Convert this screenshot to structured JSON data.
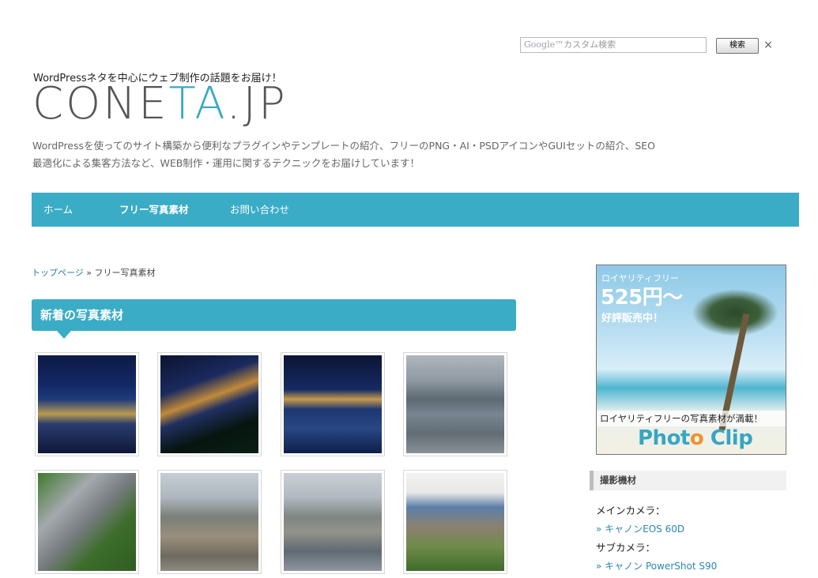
{
  "search": {
    "placeholder_brand": "Google™",
    "placeholder_text": "カスタム検索",
    "button_label": "検索",
    "close_label": "×"
  },
  "header": {
    "tagline": "WordPressネタを中心にウェブ制作の話題をお届け！",
    "logo_part1": "CONE",
    "logo_part2": "TA",
    "logo_part3": ".JP",
    "description_line1": "WordPressを使ってのサイト構築から便利なプラグインやテンプレートの紹介、フリーのPNG・AI・PSDアイコンやGUIセットの紹介、SEO",
    "description_line2": "最適化による集客方法など、WEB制作・運用に関するテクニックをお届けしています！"
  },
  "nav": {
    "items": [
      {
        "label": "ホーム"
      },
      {
        "label": "フリー写真素材"
      },
      {
        "label": "お問い合わせ"
      }
    ]
  },
  "breadcrumb": {
    "home": "トップページ",
    "separator": " » ",
    "current": "フリー写真素材"
  },
  "section": {
    "title": "新着の写真素材"
  },
  "photos": [
    {
      "icon": "night-city-photo"
    },
    {
      "icon": "night-harbor-photo"
    },
    {
      "icon": "night-port-photo"
    },
    {
      "icon": "marina-photo"
    },
    {
      "icon": "hillside-houses-photo"
    },
    {
      "icon": "city-skyline-photo"
    },
    {
      "icon": "river-town-photo"
    },
    {
      "icon": "cliff-building-photo"
    }
  ],
  "sidebar": {
    "banner": {
      "line1": "ロイヤリティフリー",
      "line2": "525円～",
      "line3": "好評販売中！",
      "strip": "ロイヤリティフリーの写真素材が満載！",
      "logo_a": "Phot",
      "logo_b": "o",
      "logo_c": " Clip"
    },
    "widget": {
      "title": "撮影機材",
      "main_camera_label": "メインカメラ：",
      "main_camera": "» キャノンEOS 60D",
      "sub_camera_label": "サブカメラ：",
      "sub_camera": "» キャノン PowerShot S90"
    }
  },
  "colors": {
    "accent": "#3aacc6",
    "link": "#2a87b3"
  }
}
